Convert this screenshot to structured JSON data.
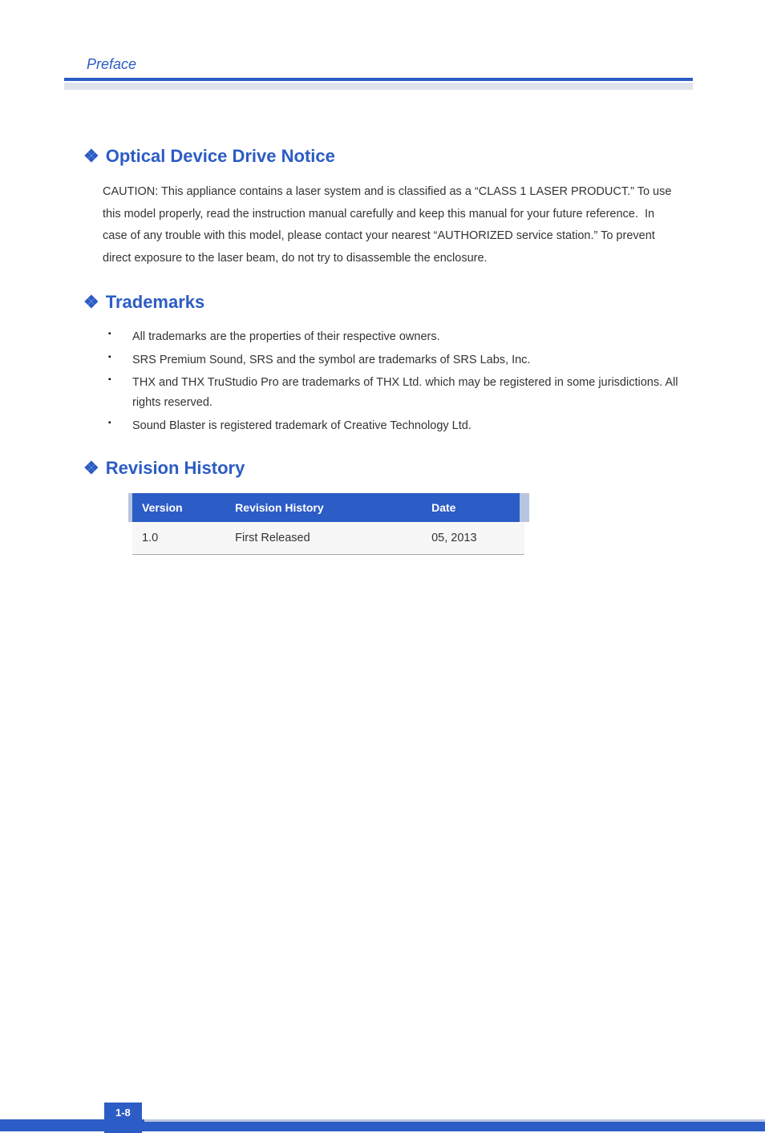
{
  "header": {
    "title": "Preface"
  },
  "sections": {
    "optical": {
      "heading": "Optical Device Drive Notice",
      "body": "CAUTION: This appliance contains a laser system and is classified as a “CLASS 1 LASER PRODUCT.” To use this model properly, read the instruction manual carefully and keep this manual for your future reference.  In case of any trouble with this model, please contact your nearest “AUTHORIZED service station.” To prevent direct exposure to the laser beam, do not try to disassemble the enclosure."
    },
    "trademarks": {
      "heading": "Trademarks",
      "items": [
        "All trademarks are the properties of their respective owners.",
        "SRS Premium Sound, SRS and the symbol are trademarks of SRS Labs, Inc.",
        "THX and THX TruStudio Pro are trademarks of THX Ltd. which may be registered in some jurisdictions. All rights reserved.",
        "Sound Blaster is registered trademark of Creative Technology Ltd."
      ]
    },
    "revision": {
      "heading": "Revision History",
      "table": {
        "headers": {
          "version": "Version",
          "history": "Revision History",
          "date": "Date"
        },
        "rows": [
          {
            "version": "1.0",
            "history": "First Released",
            "date": "05, 2013"
          }
        ]
      }
    }
  },
  "footer": {
    "page_number": "1-8"
  }
}
